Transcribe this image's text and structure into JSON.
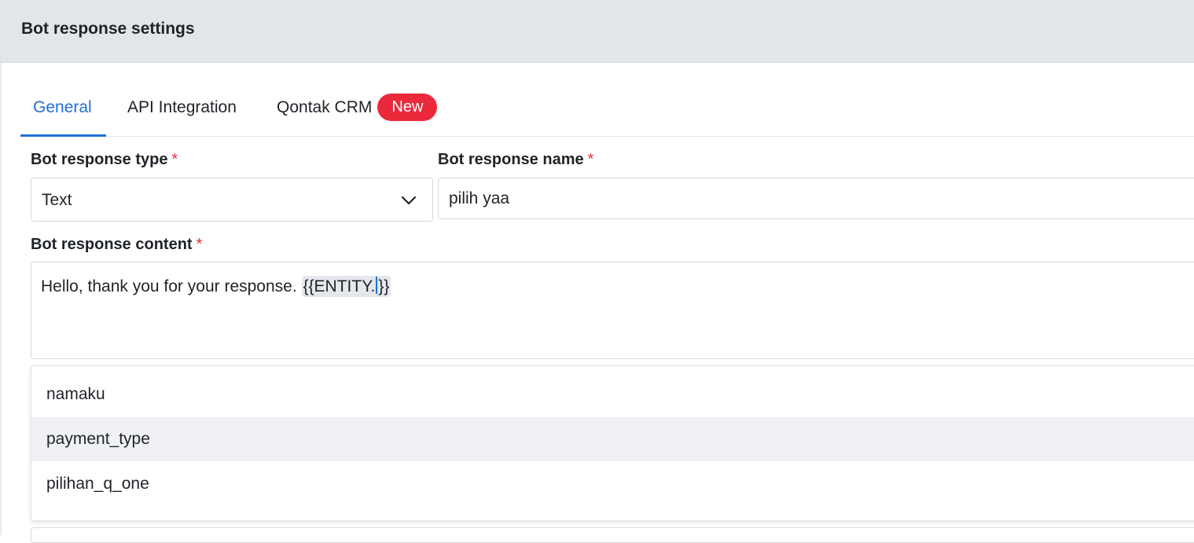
{
  "header": {
    "title": "Bot response settings"
  },
  "tabs": [
    {
      "label": "General",
      "active": true
    },
    {
      "label": "API Integration",
      "active": false
    },
    {
      "label": "Qontak CRM",
      "active": false,
      "badge": "New"
    }
  ],
  "form": {
    "required_mark": "*",
    "response_type": {
      "label": "Bot response type",
      "value": "Text"
    },
    "response_name": {
      "label": "Bot response name",
      "value": "pilih yaa"
    },
    "response_content": {
      "label": "Bot response content",
      "text_before": "Hello, thank you for your response. ",
      "entity_text": "{{ENTITY.",
      "text_after": "}}"
    }
  },
  "suggestions": {
    "highlighted_index": 1,
    "items": [
      "namaku",
      "payment_type",
      "pilihan_q_one"
    ]
  },
  "colors": {
    "accent": "#1f6fd9",
    "badge": "#ea2a3b",
    "required": "#e0303f",
    "header_bg": "#e2e5ea"
  }
}
